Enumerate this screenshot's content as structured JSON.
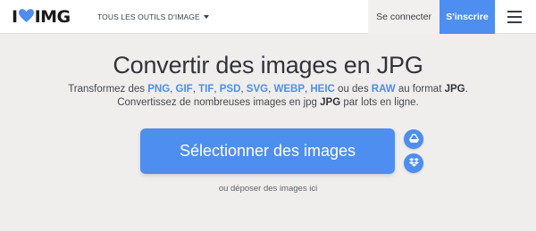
{
  "header": {
    "logo": {
      "text_left": "I",
      "text_right": "IMG"
    },
    "tools_menu_label": "TOUS LES OUTILS D'IMAGE",
    "login_label": "Se connecter",
    "signup_label": "S'inscrire"
  },
  "main": {
    "title": "Convertir des images en JPG",
    "subtitle": {
      "line1_prefix": "Transformez des ",
      "formats": [
        "PNG",
        "GIF",
        "TIF",
        "PSD",
        "SVG",
        "WEBP",
        "HEIC"
      ],
      "separator": ", ",
      "or_word": " ou des ",
      "raw": "RAW",
      "format_suffix": " au format ",
      "target": "JPG",
      "line1_end": ".",
      "line2_prefix": "Convertissez de nombreuses images en jpg ",
      "line2_target": "JPG",
      "line2_suffix": " par lots en ligne."
    },
    "select_button_label": "Sélectionner des images",
    "drop_hint": "ou déposer des images ici"
  },
  "colors": {
    "accent": "#4d8ef0",
    "logo_heart": "#4d8ef0",
    "background": "#f0eeed",
    "header": "#ffffff"
  },
  "icons": {
    "logo_heart": "heart-icon",
    "tools_caret": "caret-down-icon",
    "menu": "hamburger-menu-icon",
    "drive": "google-drive-icon",
    "dropbox": "dropbox-icon"
  }
}
